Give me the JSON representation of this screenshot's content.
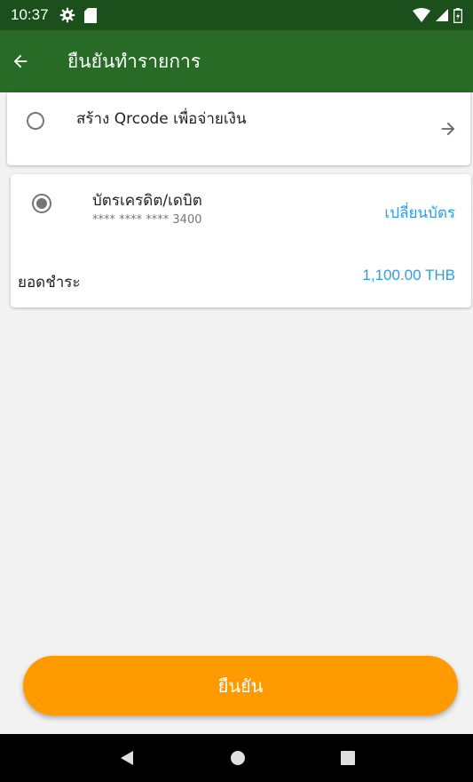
{
  "status_bar": {
    "time": "10:37",
    "icons_left": [
      "settings-icon",
      "sd-card-icon"
    ],
    "icons_right": [
      "wifi-icon",
      "signal-icon",
      "battery-icon"
    ]
  },
  "app_bar": {
    "title": "ยืนยันทำรายการ",
    "back_icon": "back-arrow-icon",
    "color": "#276b27"
  },
  "payment_options": [
    {
      "label": "สร้าง Qrcode เพื่อจ่ายเงิน",
      "selected": false,
      "trailing_icon": "arrow-right-icon"
    },
    {
      "label": "บัตรเครดิต/เดบิต",
      "card_number": "**** **** **** 3400",
      "selected": true,
      "action_label": "เปลี่ยนบัตร",
      "total_label": "ยอดชำระ",
      "total_amount": "1,100.00 THB"
    }
  ],
  "confirm_button": {
    "label": "ยืนยัน",
    "color": "#ff9b00"
  },
  "nav_bar": {
    "icons": [
      "back-icon",
      "home-icon",
      "recents-icon"
    ]
  },
  "accent_color": "#2e9ee6"
}
